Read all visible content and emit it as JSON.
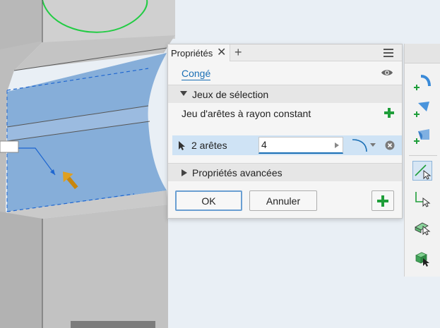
{
  "panel": {
    "tab_label": "Propriétés",
    "close_glyph": "✕",
    "add_glyph": "+",
    "feature_name": "Congé",
    "selection_section": "Jeux de sélection",
    "edge_set_label": "Jeu d'arêtes à rayon constant",
    "edge_count": "2 arêtes",
    "radius_value": "4",
    "advanced_section": "Propriétés avancées",
    "ok_label": "OK",
    "cancel_label": "Annuler"
  },
  "icons": {
    "visibility": "eye-icon",
    "menu": "hamburger-menu-icon",
    "add_edge_set": "green-plus-icon",
    "select_cursor": "arrow-cursor-icon",
    "fillet_type": "fillet-profile-icon",
    "remove": "circle-x-icon",
    "apply": "green-plus-icon"
  },
  "toolbar": {
    "tools": [
      "fillet-edge-tool",
      "fillet-face-tool",
      "fillet-full-round-tool",
      "select-edge-tool",
      "select-loop-tool",
      "select-feature-tool",
      "select-solid-tool"
    ]
  },
  "colors": {
    "accent": "#1a6fb5",
    "green": "#1f9e3a",
    "selection_bg": "#cfe3f5",
    "selected_face": "#7fa9d6"
  }
}
